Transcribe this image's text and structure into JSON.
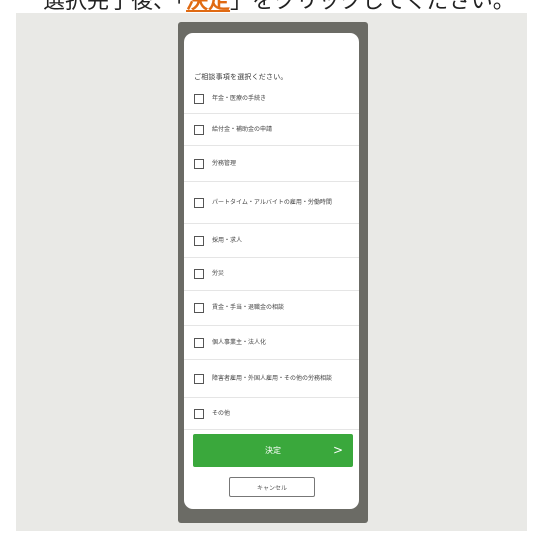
{
  "instruction": {
    "before": "選択完了後、「",
    "highlight": "決定",
    "after": "」をクリックしてください。"
  },
  "form": {
    "prompt": "ご相談事項を選択ください。",
    "options": [
      "年金・医療の手続き",
      "給付金・補助金の申請",
      "労務管理",
      "パートタイム・アルバイトの雇用・労働時間",
      "採用・求人",
      "労災",
      "賃金・手当・退職金の相談",
      "個人事業主・法人化",
      "障害者雇用・外国人雇用・その他の労務相談",
      "その他"
    ],
    "next_label": "決定",
    "next_arrow": ">",
    "cancel_label": "キャンセル"
  },
  "colors": {
    "accent_green": "#3aa83c",
    "highlight_orange": "#e06a12",
    "phone_frame": "#6b6b65",
    "background_panel": "#e9e9e6"
  }
}
